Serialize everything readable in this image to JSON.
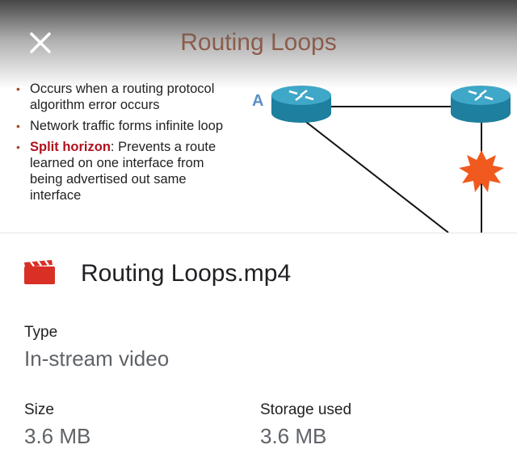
{
  "preview": {
    "slide_title": "Routing Loops",
    "bullets": [
      {
        "text": "Occurs when a routing protocol algorithm error occurs"
      },
      {
        "text": "Network traffic forms infinite loop"
      },
      {
        "highlight": "Split horizon",
        "text": ": Prevents a route learned on one interface from being advertised out same interface"
      }
    ],
    "router_label": "A",
    "close_icon": "close-icon"
  },
  "file": {
    "icon": "video-file-icon",
    "icon_color": "#d93025",
    "name": "Routing Loops.mp4"
  },
  "details": {
    "type_label": "Type",
    "type_value": "In-stream video",
    "size_label": "Size",
    "size_value": "3.6 MB",
    "storage_label": "Storage used",
    "storage_value": "3.6 MB"
  }
}
